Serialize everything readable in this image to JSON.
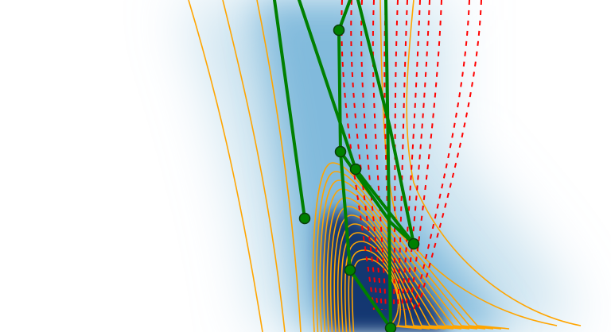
{
  "colors": {
    "background": "#ffffff",
    "density_light": "#f4f9ff",
    "density_mid": "#6aaed6",
    "density_dark": "#08306b",
    "contour": "#ffa500",
    "trajectory": "#008000",
    "trajectory_marker_edge": "#0a3d0a",
    "flow_dotted": "#ff0000"
  }
}
